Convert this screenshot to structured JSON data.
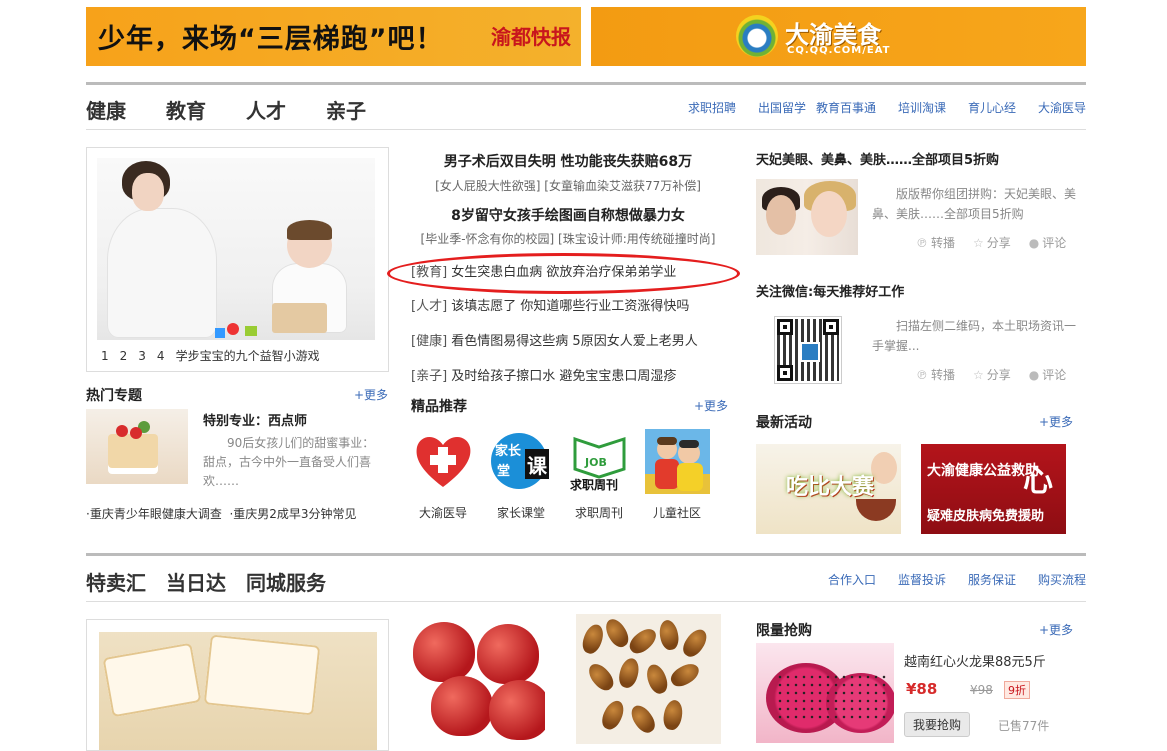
{
  "banners": {
    "left": {
      "slogan": "少年，来场“三层梯跑”吧！",
      "brand": "渝都快报"
    },
    "right": {
      "brand": "大渝美食",
      "url": "CQ.QQ.COM/EAT"
    }
  },
  "section1": {
    "tabs": [
      "健康",
      "教育",
      "人才",
      "亲子"
    ],
    "links": [
      "求职招聘",
      "出国留学",
      "教育百事通",
      "培训淘课",
      "育儿心经",
      "大渝医导"
    ]
  },
  "slider": {
    "pages": [
      "1",
      "2",
      "3",
      "4"
    ],
    "caption": "学步宝宝的九个益智小游戏"
  },
  "headlines": [
    {
      "title": "男子术后双目失明 性功能丧失获赔68万",
      "subs": "[女人屁股大性欲强] [女童输血染艾滋获77万补偿]"
    },
    {
      "title": "8岁留守女孩手绘图画自称想做暴力女",
      "subs": "[毕业季-怀念有你的校园] [珠宝设计师:用传统碰撞时尚]"
    }
  ],
  "news": [
    {
      "cat": "[教育]",
      "text": " 女生突患白血病 欲放弃治疗保弟弟学业"
    },
    {
      "cat": "[人才]",
      "text": " 该填志愿了 你知道哪些行业工资涨得快吗"
    },
    {
      "cat": "[健康]",
      "text": " 看色情图易得这些病 5原因女人爱上老男人"
    },
    {
      "cat": "[亲子]",
      "text": " 及时给孩子擦口水 避免宝宝患口周湿疹"
    }
  ],
  "more_label": "+更多",
  "hot_topics": {
    "title": "热门专题",
    "feature_title": "特别专业：西点师",
    "feature_text": "90后女孩儿们的甜蜜事业：甜点，古今中外一直备受人们喜欢……",
    "links": "·重庆青少年眼健康大调查  ·重庆男2成早3分钟常见"
  },
  "recommend": {
    "title": "精品推荐",
    "items": [
      "大渝医导",
      "家长课堂",
      "求职周刊",
      "儿童社区"
    ]
  },
  "promo1": {
    "title": "天妃美眼、美鼻、美肤……全部项目5折购",
    "text": "版版帮你组团拼购：天妃美眼、美鼻、美肤……全部项目5折购"
  },
  "promo2": {
    "title": "关注微信:每天推荐好工作",
    "text": "扫描左侧二维码，本土职场资讯一手掌握..."
  },
  "actions": [
    "转播",
    "分享",
    "评论"
  ],
  "activities": {
    "title": "最新活动",
    "img1_text": "吃比大赛",
    "img2_top": "大渝健康公益救助",
    "img2_bottom": "疑难皮肤病免费援助",
    "img2_big": "心"
  },
  "section2": {
    "tabs": [
      "特卖汇",
      "当日达",
      "同城服务"
    ],
    "links": [
      "合作入口",
      "监督投诉",
      "服务保证",
      "购买流程"
    ]
  },
  "flash_sale": {
    "title": "限量抢购",
    "product": "越南红心火龙果88元5斤",
    "price": "¥88",
    "old_price": "¥98",
    "discount": "9折",
    "buy": "我要抢购",
    "sold": "已售77件"
  },
  "colors": {
    "accent_blue": "#3a6ab7",
    "highlight_red": "#e41e1e",
    "banner_orange": "#f7a21a"
  }
}
